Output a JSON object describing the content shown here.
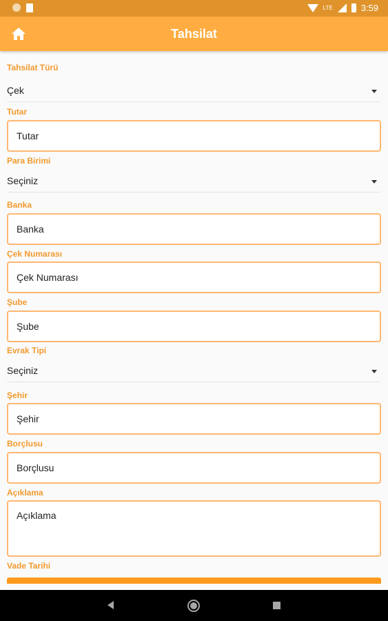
{
  "status_bar": {
    "time": "3:59",
    "network": "LTE"
  },
  "app_bar": {
    "title": "Tahsilat"
  },
  "form": {
    "tahsilat_turu": {
      "label": "Tahsilat Türü",
      "value": "Çek"
    },
    "tutar": {
      "label": "Tutar",
      "placeholder": "Tutar"
    },
    "para_birimi": {
      "label": "Para Birimi",
      "value": "Seçiniz"
    },
    "banka": {
      "label": "Banka",
      "placeholder": "Banka"
    },
    "cek_numarasi": {
      "label": "Çek Numarası",
      "placeholder": "Çek Numarası"
    },
    "sube": {
      "label": "Şube",
      "placeholder": "Şube"
    },
    "evrak_tipi": {
      "label": "Evrak Tipi",
      "value": "Seçiniz"
    },
    "sehir": {
      "label": "Şehir",
      "placeholder": "Şehir"
    },
    "borclusu": {
      "label": "Borçlusu",
      "placeholder": "Borçlusu"
    },
    "aciklama": {
      "label": "Açıklama",
      "placeholder": "Açıklama"
    },
    "vade_tarihi": {
      "label": "Vade Tarihi"
    }
  },
  "colors": {
    "primary": "#ffad42",
    "status_bar": "#e0932a",
    "label": "#f29a2e",
    "field_border": "#ffb771",
    "button": "#ff9a1f"
  }
}
